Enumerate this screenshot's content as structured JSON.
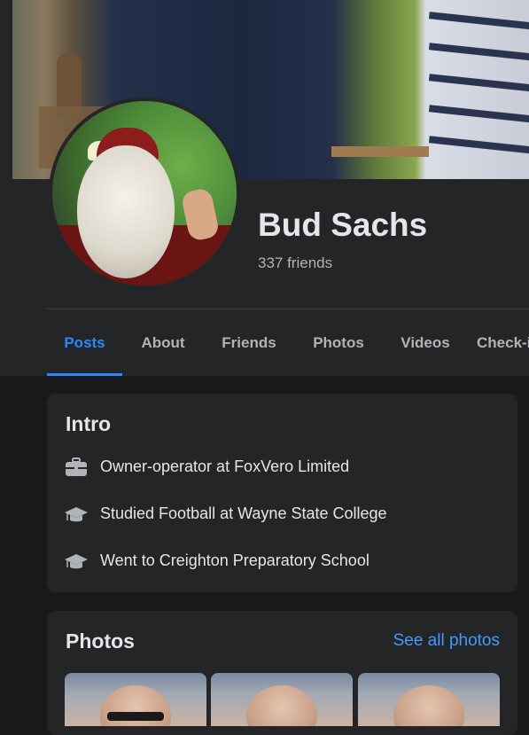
{
  "profile": {
    "name": "Bud Sachs",
    "friends_count": "337 friends"
  },
  "tabs": [
    {
      "label": "Posts",
      "active": true
    },
    {
      "label": "About"
    },
    {
      "label": "Friends"
    },
    {
      "label": "Photos"
    },
    {
      "label": "Videos"
    },
    {
      "label": "Check-ins"
    }
  ],
  "intro": {
    "title": "Intro",
    "items": [
      {
        "icon": "briefcase-icon",
        "text": "Owner-operator at FoxVero Limited"
      },
      {
        "icon": "graduation-cap-icon",
        "text": "Studied Football at Wayne State College"
      },
      {
        "icon": "graduation-cap-icon",
        "text": "Went to Creighton Preparatory School"
      }
    ]
  },
  "photos": {
    "title": "Photos",
    "see_all": "See all photos"
  },
  "colors": {
    "accent": "#2d88ff",
    "link": "#4599ff",
    "card": "#242526",
    "page": "#18191a"
  }
}
